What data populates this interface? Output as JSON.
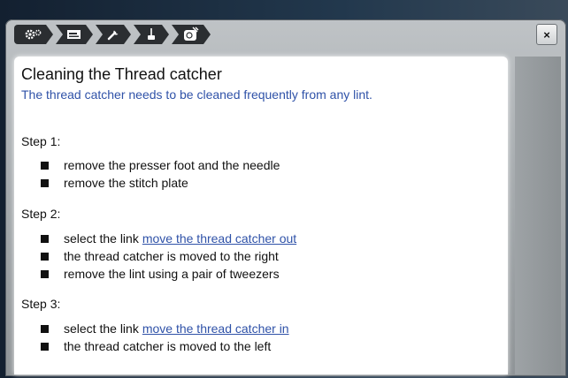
{
  "window": {
    "breadcrumb": [
      {
        "name": "settings-icon"
      },
      {
        "name": "machine-icon"
      },
      {
        "name": "wrench-icon"
      },
      {
        "name": "brush-icon"
      },
      {
        "name": "thread-catcher-icon"
      }
    ],
    "close_label": "×"
  },
  "content": {
    "title": "Cleaning the Thread catcher",
    "subtitle": "The thread catcher needs to be cleaned frequently from any lint.",
    "steps": [
      {
        "label": "Step 1:",
        "items": [
          {
            "text": "remove the presser foot and the needle"
          },
          {
            "text": "remove the stitch plate"
          }
        ]
      },
      {
        "label": "Step 2:",
        "items": [
          {
            "text": "select the link",
            "link": "move the thread catcher out"
          },
          {
            "text": "the thread catcher is moved to the right"
          },
          {
            "text": "remove the lint using a pair of tweezers"
          }
        ]
      },
      {
        "label": "Step 3:",
        "items": [
          {
            "text": "select the link",
            "link": "move the thread catcher in"
          },
          {
            "text": "the thread catcher is moved to the left"
          }
        ]
      }
    ]
  },
  "colors": {
    "link": "#2f52a8",
    "subtitle": "#2f52a8",
    "crumb_bg": "#2b2e31"
  }
}
